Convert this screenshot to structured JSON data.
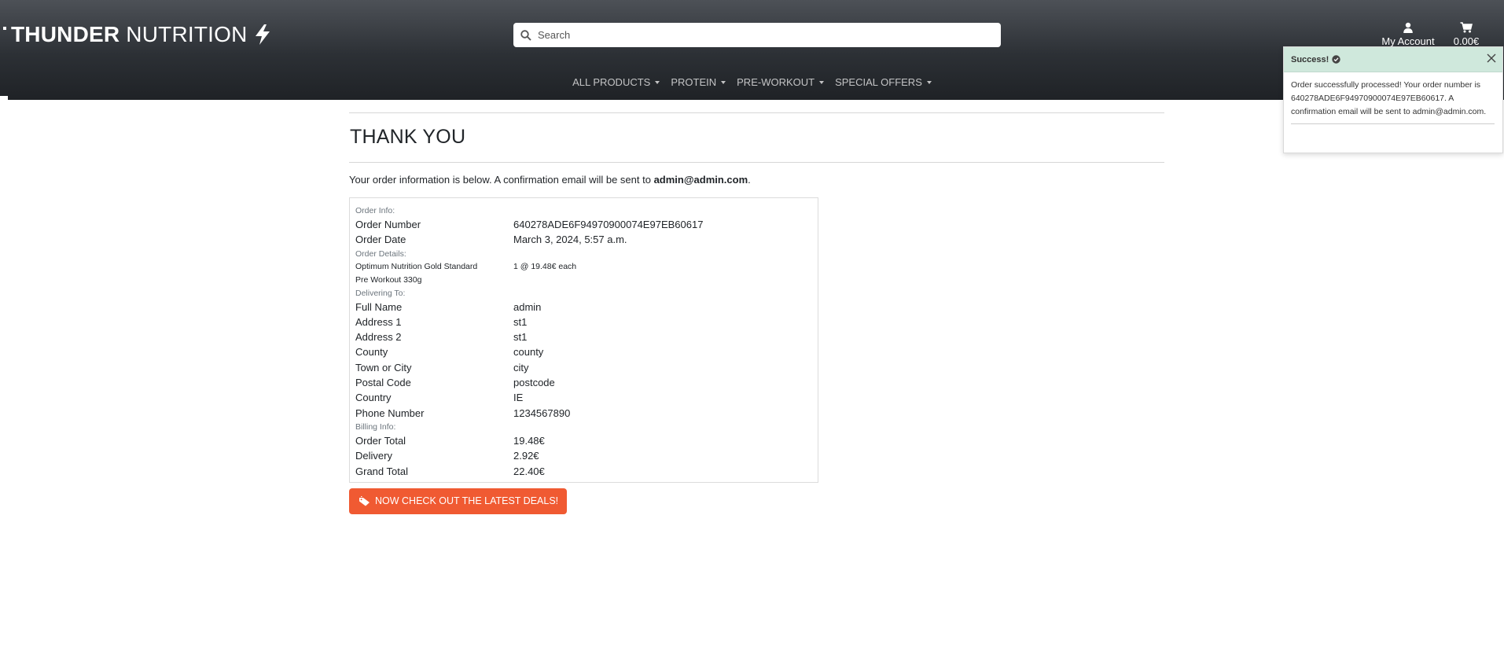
{
  "brand": {
    "bold": "THUNDER",
    "light": "NUTRITION"
  },
  "search": {
    "placeholder": "Search"
  },
  "account": {
    "label": "My Account"
  },
  "cart": {
    "total": "0.00€"
  },
  "nav": [
    {
      "label": "ALL PRODUCTS"
    },
    {
      "label": "PROTEIN"
    },
    {
      "label": "PRE-WORKOUT"
    },
    {
      "label": "SPECIAL OFFERS"
    }
  ],
  "page": {
    "title": "THANK YOU",
    "intro_prefix": "Your order information is below. A confirmation email will be sent to ",
    "intro_email": "admin@admin.com",
    "intro_suffix": "."
  },
  "order": {
    "info_label": "Order Info:",
    "number_label": "Order Number",
    "number": "640278ADE6F94970900074E97EB60617",
    "date_label": "Order Date",
    "date": "March 3, 2024, 5:57 a.m.",
    "details_label": "Order Details:",
    "item_name_line1": "Optimum Nutrition Gold Standard",
    "item_name_line2": "Pre Workout 330g",
    "item_qty": "1 @ 19.48€ each",
    "delivery_label": "Delivering To:",
    "delivery": [
      {
        "k": "Full Name",
        "v": "admin"
      },
      {
        "k": "Address 1",
        "v": "st1"
      },
      {
        "k": "Address 2",
        "v": "st1"
      },
      {
        "k": "County",
        "v": "county"
      },
      {
        "k": "Town or City",
        "v": "city"
      },
      {
        "k": "Postal Code",
        "v": "postcode"
      },
      {
        "k": "Country",
        "v": "IE"
      },
      {
        "k": "Phone Number",
        "v": "1234567890"
      }
    ],
    "billing_label": "Billing Info:",
    "billing": [
      {
        "k": "Order Total",
        "v": "19.48€"
      },
      {
        "k": "Delivery",
        "v": "2.92€"
      },
      {
        "k": "Grand Total",
        "v": "22.40€"
      }
    ]
  },
  "deals_button": {
    "label": "NOW CHECK OUT THE LATEST DEALS!"
  },
  "toast": {
    "title": "Success!",
    "message": "Order successfully processed! Your order number is 640278ADE6F94970900074E97EB60617. A confirmation email will be sent to admin@admin.com."
  },
  "colors": {
    "header_dark": "#1f2226",
    "accent_orange": "#f05a32",
    "toast_header": "#cfe8dc"
  },
  "icons": [
    "bolt-icon",
    "search-icon",
    "user-icon",
    "cart-icon",
    "caret-down-icon",
    "tag-icon",
    "check-circle-icon",
    "close-icon"
  ]
}
